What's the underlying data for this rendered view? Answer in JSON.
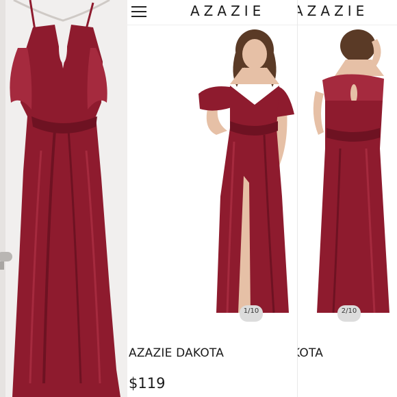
{
  "middle_screen": {
    "brand": "AZAZIE",
    "product_name": "AZAZIE DAKOTA",
    "price": "$119",
    "image_counter": "1/10"
  },
  "right_screen": {
    "brand": "AZAZIE",
    "product_name": "KOTA",
    "image_counter": "2/10"
  },
  "colors": {
    "dress": "#8e1b2e",
    "dress_shadow": "#6e1222",
    "dress_highlight": "#a52a3e",
    "skin": "#e6c0a6",
    "hair": "#5a3a26"
  },
  "icons": {
    "menu": "hamburger-menu-icon"
  }
}
